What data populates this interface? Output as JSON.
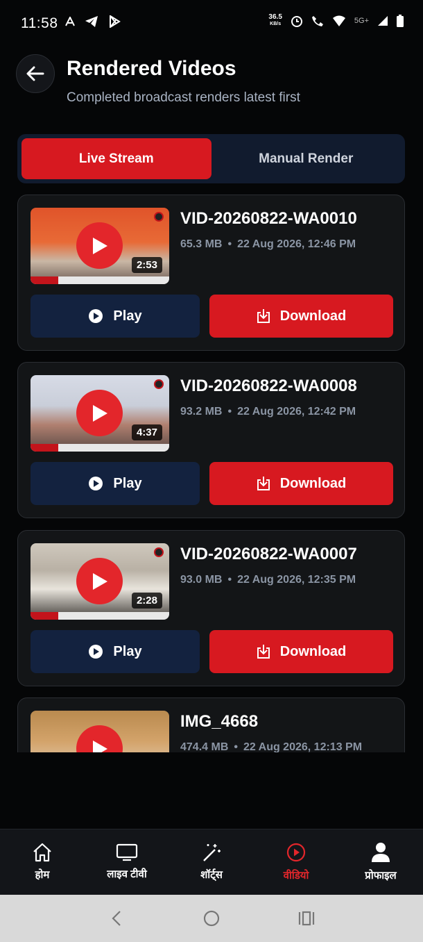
{
  "status_bar": {
    "time": "11:58",
    "net_speed": "36.5",
    "net_unit": "KB/s",
    "network_type": "5G+"
  },
  "header": {
    "title": "Rendered Videos",
    "subtitle": "Completed broadcast renders latest first"
  },
  "tabs": [
    {
      "label": "Live Stream",
      "active": true
    },
    {
      "label": "Manual Render",
      "active": false
    }
  ],
  "videos": [
    {
      "title": "VID-20260822-WA0010",
      "size": "65.3 MB",
      "date": "22 Aug 2026, 12:46 PM",
      "duration": "2:53",
      "play_label": "Play",
      "download_label": "Download"
    },
    {
      "title": "VID-20260822-WA0008",
      "size": "93.2 MB",
      "date": "22 Aug 2026, 12:42 PM",
      "duration": "4:37",
      "play_label": "Play",
      "download_label": "Download"
    },
    {
      "title": "VID-20260822-WA0007",
      "size": "93.0 MB",
      "date": "22 Aug 2026, 12:35 PM",
      "duration": "2:28",
      "play_label": "Play",
      "download_label": "Download"
    },
    {
      "title": "IMG_4668",
      "size": "474.4 MB",
      "date": "22 Aug 2026, 12:13 PM"
    }
  ],
  "meta_separator": "•",
  "bottom_nav": [
    {
      "label": "होम",
      "icon": "home-icon",
      "active": false
    },
    {
      "label": "लाइव टीवी",
      "icon": "tv-icon",
      "active": false
    },
    {
      "label": "शॉर्ट्स",
      "icon": "magic-wand-icon",
      "active": false
    },
    {
      "label": "वीडियो",
      "icon": "video-play-icon",
      "active": true
    },
    {
      "label": "प्रोफाइल",
      "icon": "profile-icon",
      "active": false
    }
  ],
  "colors": {
    "accent": "#d71920",
    "background": "#050607",
    "card": "#131517",
    "play_button": "#13223f"
  }
}
